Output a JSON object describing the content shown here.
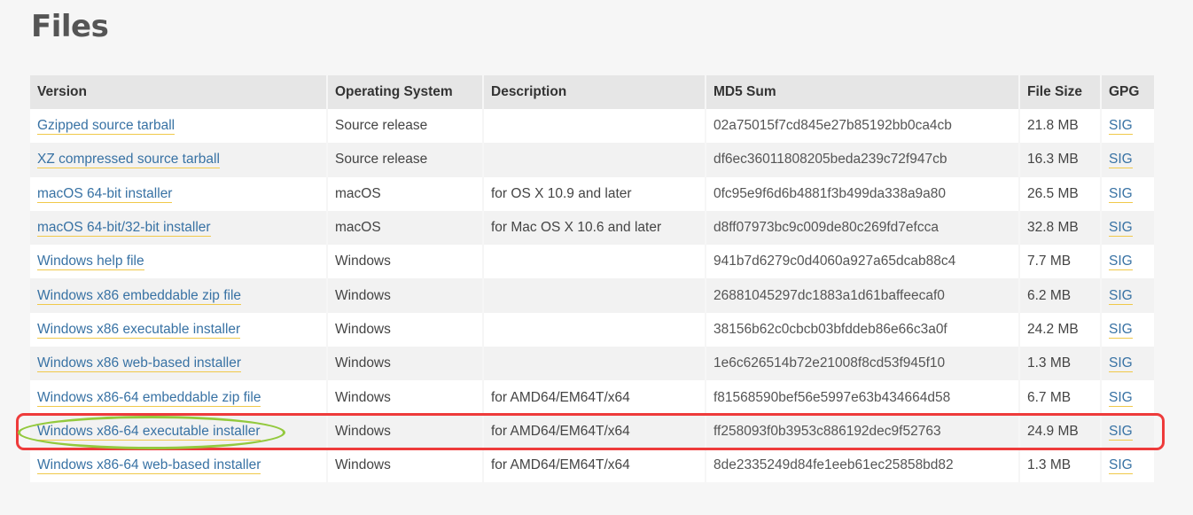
{
  "page": {
    "title": "Files"
  },
  "table": {
    "headers": [
      "Version",
      "Operating System",
      "Description",
      "MD5 Sum",
      "File Size",
      "GPG"
    ],
    "rows": [
      {
        "version": "Gzipped source tarball",
        "os": "Source release",
        "description": "",
        "md5": "02a75015f7cd845e27b85192bb0ca4cb",
        "size": "21.8 MB",
        "gpg": "SIG"
      },
      {
        "version": "XZ compressed source tarball",
        "os": "Source release",
        "description": "",
        "md5": "df6ec36011808205beda239c72f947cb",
        "size": "16.3 MB",
        "gpg": "SIG"
      },
      {
        "version": "macOS 64-bit installer",
        "os": "macOS",
        "description": "for OS X 10.9 and later",
        "md5": "0fc95e9f6d6b4881f3b499da338a9a80",
        "size": "26.5 MB",
        "gpg": "SIG"
      },
      {
        "version": "macOS 64-bit/32-bit installer",
        "os": "macOS",
        "description": "for Mac OS X 10.6 and later",
        "md5": "d8ff07973bc9c009de80c269fd7efcca",
        "size": "32.8 MB",
        "gpg": "SIG"
      },
      {
        "version": "Windows help file",
        "os": "Windows",
        "description": "",
        "md5": "941b7d6279c0d4060a927a65dcab88c4",
        "size": "7.7 MB",
        "gpg": "SIG"
      },
      {
        "version": "Windows x86 embeddable zip file",
        "os": "Windows",
        "description": "",
        "md5": "26881045297dc1883a1d61baffeecaf0",
        "size": "6.2 MB",
        "gpg": "SIG"
      },
      {
        "version": "Windows x86 executable installer",
        "os": "Windows",
        "description": "",
        "md5": "38156b62c0cbcb03bfddeb86e66c3a0f",
        "size": "24.2 MB",
        "gpg": "SIG"
      },
      {
        "version": "Windows x86 web-based installer",
        "os": "Windows",
        "description": "",
        "md5": "1e6c626514b72e21008f8cd53f945f10",
        "size": "1.3 MB",
        "gpg": "SIG"
      },
      {
        "version": "Windows x86-64 embeddable zip file",
        "os": "Windows",
        "description": "for AMD64/EM64T/x64",
        "md5": "f81568590bef56e5997e63b434664d58",
        "size": "6.7 MB",
        "gpg": "SIG"
      },
      {
        "version": "Windows x86-64 executable installer",
        "os": "Windows",
        "description": "for AMD64/EM64T/x64",
        "md5": "ff258093f0b3953c886192dec9f52763",
        "size": "24.9 MB",
        "gpg": "SIG"
      },
      {
        "version": "Windows x86-64 web-based installer",
        "os": "Windows",
        "description": "for AMD64/EM64T/x64",
        "md5": "8de2335249d84fe1eeb61ec25858bd82",
        "size": "1.3 MB",
        "gpg": "SIG"
      }
    ]
  },
  "annotations": {
    "highlight_row_color": "#ee3b3b",
    "highlight_link_color": "#93c93d"
  },
  "colors": {
    "link": "#3872a4",
    "link_underline": "#f0c94a",
    "header_bg": "#e6e6e6"
  }
}
